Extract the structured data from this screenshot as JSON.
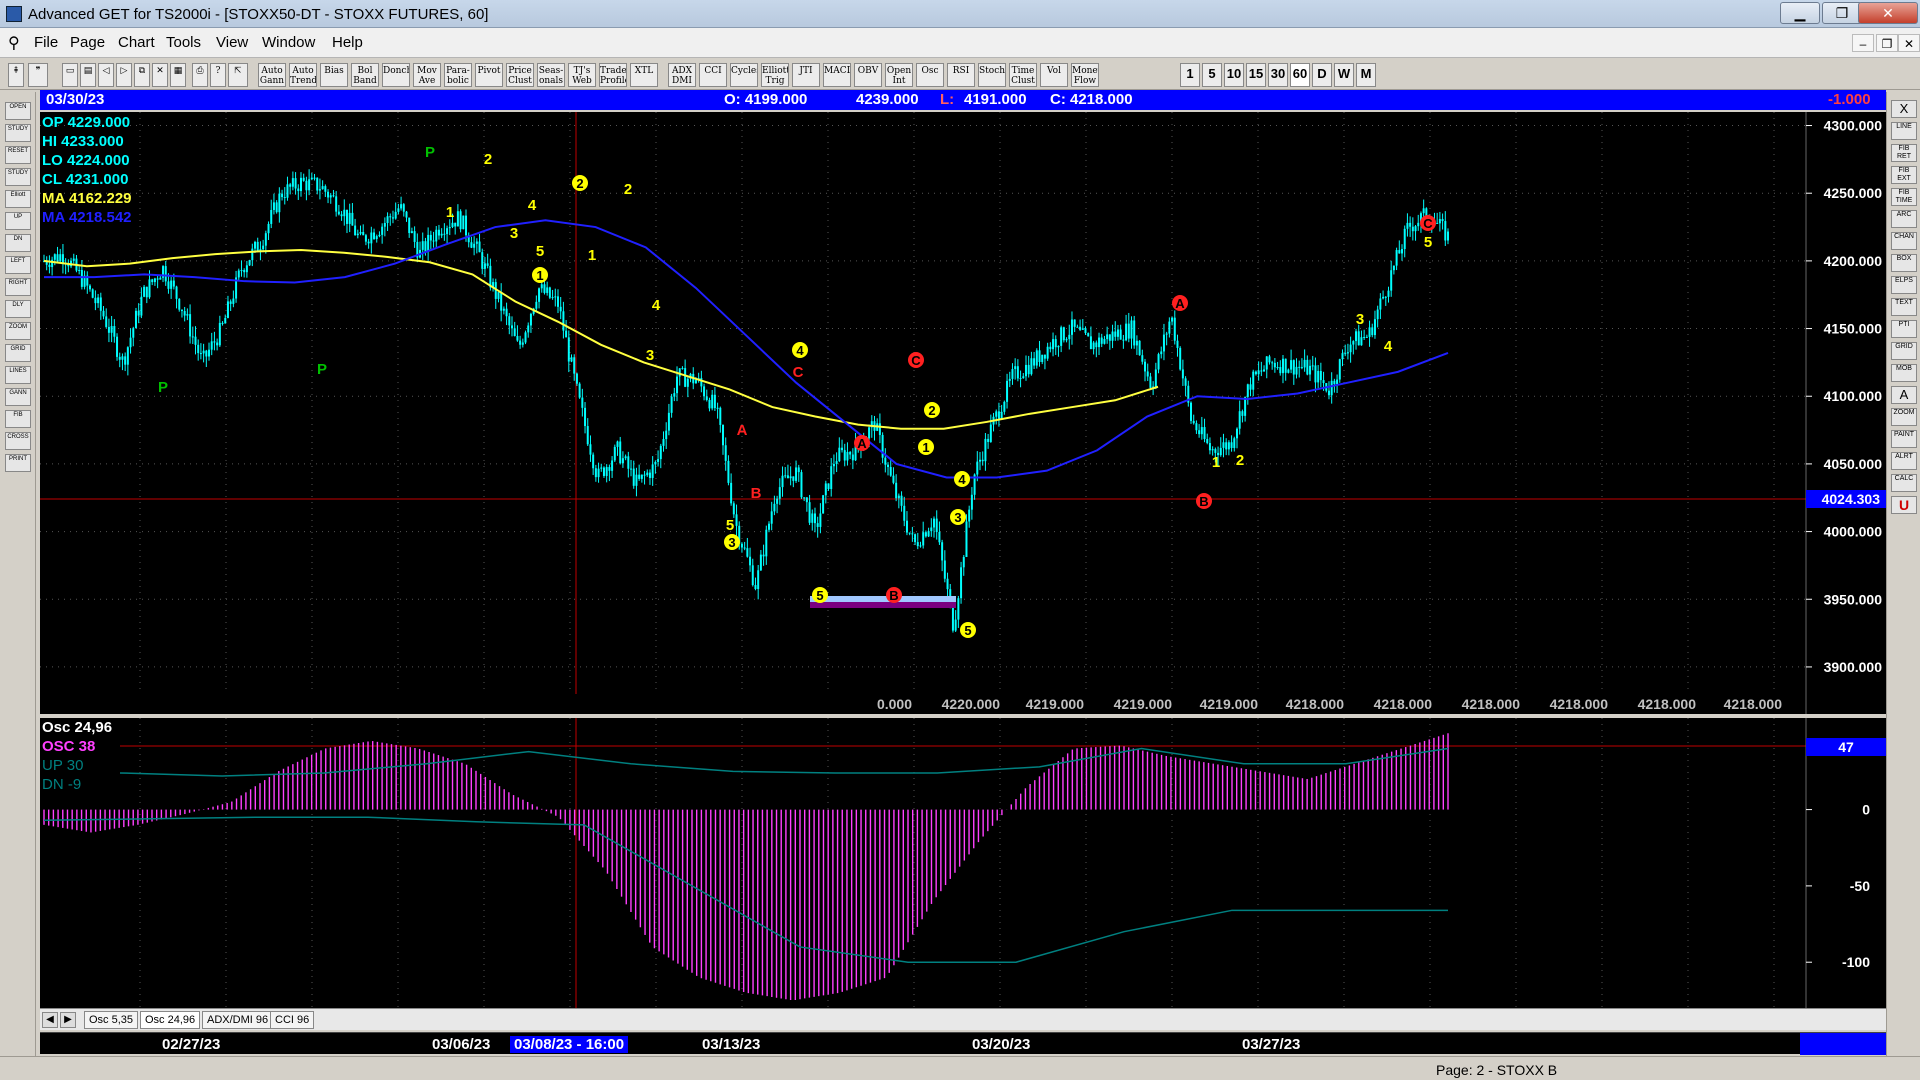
{
  "window": {
    "title": "Advanced GET for TS2000i - [STOXX50-DT - STOXX FUTURES, 60]",
    "min": "▁",
    "max": "❐",
    "close": "✕"
  },
  "menu": [
    "File",
    "Page",
    "Chart",
    "Tools",
    "View",
    "Window",
    "Help"
  ],
  "mdi": [
    "‒",
    "❐",
    "✕"
  ],
  "toolbar": {
    "indicators": [
      "Auto Gann",
      "Auto Trend",
      "Bias",
      "Bol Band",
      "Donch",
      "Mov Ave",
      "Para-bolic",
      "Pivot",
      "Price Clust",
      "Seas-onals",
      "TJ's Web",
      "Trade Profile",
      "XTL",
      "ADX DMI",
      "CCI",
      "Cycles",
      "Elliott Trig",
      "JTI",
      "MACD",
      "OBV",
      "Open Int",
      "Osc",
      "RSI",
      "Stoch",
      "Time Clust",
      "Vol",
      "Money Flow"
    ],
    "timeframes": [
      "1",
      "5",
      "10",
      "15",
      "30",
      "60",
      "D",
      "W",
      "M"
    ]
  },
  "left_tools": [
    "OPEN",
    "STUDY",
    "RESET",
    "STUDY",
    "Elliott",
    "UP",
    "DN",
    "LEFT",
    "RIGHT",
    "DLY",
    "ZOOM",
    "GRID",
    "LINES",
    "GANN",
    "FIB",
    "CROSS",
    "PRINT"
  ],
  "right_tools": [
    "X",
    "LINE",
    "FIB RET",
    "FIB EXT",
    "FIB TIME",
    "ARC",
    "CHAN",
    "BOX",
    "ELPS",
    "TEXT",
    "PTI",
    "GRID",
    "MOB",
    "A",
    "ZOOM",
    "PAINT",
    "ALRT",
    "CALC",
    "U"
  ],
  "info_bar": {
    "date": "03/30/23",
    "open": "O: 4199.000",
    "high": "4239.000",
    "low_label": "L:",
    "low": "4191.000",
    "close": "C: 4218.000",
    "change": "-1.000"
  },
  "legend": {
    "op": "OP  4229.000",
    "hi": "HI   4233.000",
    "lo": "LO  4224.000",
    "cl": "CL  4231.000",
    "ma1": "MA  4162.229",
    "ma2": "MA  4218.542"
  },
  "colors": {
    "background": "#000000",
    "bars": "#00ffff",
    "ma_fast": "#ffff40",
    "ma_slow": "#2020ff",
    "osc_histogram": "#ff40ff",
    "osc_band": "#008080",
    "cursor_line": "#c00000",
    "elliott_yellow": "#ffff00",
    "elliott_red": "#ff2020",
    "pivot_green": "#00c000"
  },
  "price_axis": {
    "ticks": [
      "4300.000",
      "4250.000",
      "4200.000",
      "4150.000",
      "4100.000",
      "4050.000",
      "4000.000",
      "3950.000",
      "3900.000"
    ],
    "cursor_price": "4024.303"
  },
  "bottom_price_labels": [
    "0.000",
    "4220.000",
    "4219.000",
    "4219.000",
    "4219.000",
    "4218.000",
    "4218.000",
    "4218.000",
    "4218.000",
    "4218.000",
    "4218.000"
  ],
  "elliott_labels": [
    {
      "t": "P",
      "c": "green"
    },
    {
      "t": "2",
      "c": "yellow"
    },
    {
      "t": "1",
      "c": "yellow"
    },
    {
      "t": "4",
      "c": "yellow"
    },
    {
      "t": "3",
      "c": "yellow"
    },
    {
      "t": "5",
      "c": "yellow"
    },
    {
      "t": "2",
      "c": "yellow",
      "circle": true
    },
    {
      "t": "2",
      "c": "yellow"
    },
    {
      "t": "1",
      "c": "yellow"
    },
    {
      "t": "1",
      "c": "yellow",
      "circle": true
    },
    {
      "t": "P",
      "c": "green"
    },
    {
      "t": "P",
      "c": "green"
    },
    {
      "t": "4",
      "c": "yellow"
    },
    {
      "t": "3",
      "c": "yellow"
    },
    {
      "t": "A",
      "c": "red"
    },
    {
      "t": "B",
      "c": "red"
    },
    {
      "t": "5",
      "c": "yellow"
    },
    {
      "t": "3",
      "c": "yellow",
      "circle": true
    },
    {
      "t": "4",
      "c": "yellow",
      "circle": true
    },
    {
      "t": "C",
      "c": "red"
    },
    {
      "t": "A",
      "c": "red",
      "circle": true
    },
    {
      "t": "5",
      "c": "yellow",
      "circle": true
    },
    {
      "t": "B",
      "c": "red",
      "circle": true
    },
    {
      "t": "C",
      "c": "red",
      "circle": true
    },
    {
      "t": "2",
      "c": "yellow",
      "circle": true
    },
    {
      "t": "1",
      "c": "yellow",
      "circle": true
    },
    {
      "t": "4",
      "c": "yellow",
      "circle": true
    },
    {
      "t": "3",
      "c": "yellow",
      "circle": true
    },
    {
      "t": "5",
      "c": "yellow",
      "circle": true
    },
    {
      "t": "A",
      "c": "red",
      "circle": true
    },
    {
      "t": "B",
      "c": "red",
      "circle": true
    },
    {
      "t": "1",
      "c": "yellow"
    },
    {
      "t": "2",
      "c": "yellow"
    },
    {
      "t": "3",
      "c": "yellow"
    },
    {
      "t": "4",
      "c": "yellow"
    },
    {
      "t": "5",
      "c": "yellow"
    },
    {
      "t": "C",
      "c": "red",
      "circle": true
    }
  ],
  "osc": {
    "title": "Osc 24,96",
    "osc": "OSC 38",
    "up": "UP   30",
    "dn": "DN   -9",
    "axis_ticks": [
      "0",
      "-50",
      "-100"
    ],
    "value_box": "47"
  },
  "tabs": [
    "Osc 5,35",
    "Osc 24,96",
    "ADX/DMI 96",
    "CCI 96"
  ],
  "tab_arrows": [
    "◀",
    "▶"
  ],
  "dates": [
    "02/27/23",
    "03/06/23",
    "03/08/23 - 16:00",
    "03/13/23",
    "03/20/23",
    "03/27/23"
  ],
  "status": "Page: 2 - STOXX B",
  "chart_data": {
    "type": "candlestick",
    "title": "STOXX50-DT - STOXX FUTURES, 60",
    "ylim": [
      3880,
      4310
    ],
    "x": [
      "02/27/23",
      "03/06/23",
      "03/13/23",
      "03/20/23",
      "03/27/23"
    ],
    "price_path": [
      4200,
      4205,
      4185,
      4160,
      4125,
      4175,
      4195,
      4165,
      4125,
      4150,
      4195,
      4215,
      4250,
      4258,
      4255,
      4240,
      4215,
      4225,
      4240,
      4205,
      4225,
      4232,
      4205,
      4170,
      4135,
      4180,
      4168,
      4100,
      4040,
      4060,
      4035,
      4050,
      4115,
      4112,
      4090,
      4005,
      3960,
      4030,
      4045,
      4000,
      4055,
      4060,
      4080,
      4030,
      3990,
      4010,
      3930,
      4040,
      4080,
      4115,
      4125,
      4140,
      4150,
      4138,
      4145,
      4150,
      4108,
      4160,
      4083,
      4060,
      4065,
      4110,
      4125,
      4123,
      4120,
      4105,
      4140,
      4145,
      4185,
      4225,
      4235,
      4218
    ],
    "ma_fast_path": [
      4200,
      4196,
      4198,
      4202,
      4205,
      4207,
      4208,
      4206,
      4203,
      4199,
      4190,
      4170,
      4155,
      4138,
      4125,
      4115,
      4105,
      4092,
      4085,
      4079,
      4076,
      4076,
      4081,
      4087,
      4092,
      4097,
      4107
    ],
    "ma_slow_path": [
      4188,
      4188,
      4190,
      4188,
      4185,
      4184,
      4188,
      4198,
      4212,
      4225,
      4230,
      4225,
      4210,
      4180,
      4145,
      4110,
      4080,
      4050,
      4040,
      4040,
      4045,
      4060,
      4085,
      4100,
      4098,
      4102,
      4110,
      4118,
      4132
    ],
    "osc_path": [
      -10,
      -15,
      -10,
      -3,
      5,
      25,
      40,
      45,
      40,
      30,
      10,
      -5,
      -40,
      -90,
      -110,
      -120,
      -125,
      -120,
      -110,
      -60,
      -20,
      15,
      40,
      42,
      35,
      30,
      25,
      20,
      30,
      40,
      50
    ],
    "osc_band_up": [
      24,
      22,
      24,
      30,
      38,
      30,
      25,
      24,
      24,
      28,
      40,
      30,
      30,
      40
    ],
    "osc_band_dn": [
      -7,
      -6,
      -5,
      -5,
      -8,
      -10,
      -50,
      -90,
      -100,
      -100,
      -80,
      -66,
      -66,
      -66
    ],
    "osc_ylim": [
      -130,
      60
    ]
  }
}
